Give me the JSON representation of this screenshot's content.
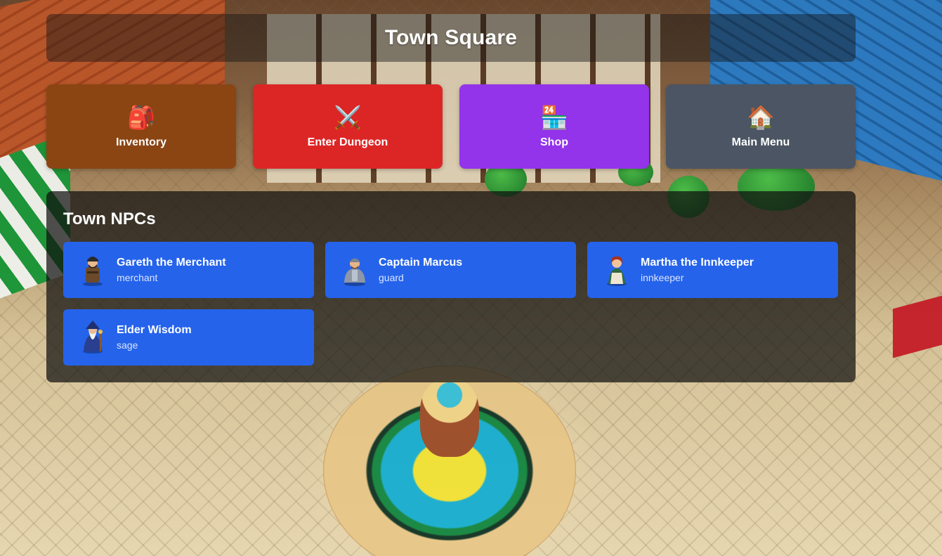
{
  "title": "Town Square",
  "actions": [
    {
      "label": "Inventory",
      "icon": "backpack-icon",
      "glyph": "🎒",
      "color": "#8b4513"
    },
    {
      "label": "Enter Dungeon",
      "icon": "crossed-swords-icon",
      "glyph": "⚔️",
      "color": "#dc2626"
    },
    {
      "label": "Shop",
      "icon": "convenience-store-icon",
      "glyph": "🏪",
      "color": "#9333ea"
    },
    {
      "label": "Main Menu",
      "icon": "house-icon",
      "glyph": "🏠",
      "color": "#4b5563"
    }
  ],
  "npc_panel": {
    "title": "Town NPCs",
    "npcs": [
      {
        "name": "Gareth the Merchant",
        "role": "merchant",
        "avatar": "merchant-avatar"
      },
      {
        "name": "Captain Marcus",
        "role": "guard",
        "avatar": "guard-avatar"
      },
      {
        "name": "Martha the Innkeeper",
        "role": "innkeeper",
        "avatar": "innkeeper-avatar"
      },
      {
        "name": "Elder Wisdom",
        "role": "sage",
        "avatar": "sage-avatar"
      }
    ],
    "card_color": "#2563eb"
  }
}
